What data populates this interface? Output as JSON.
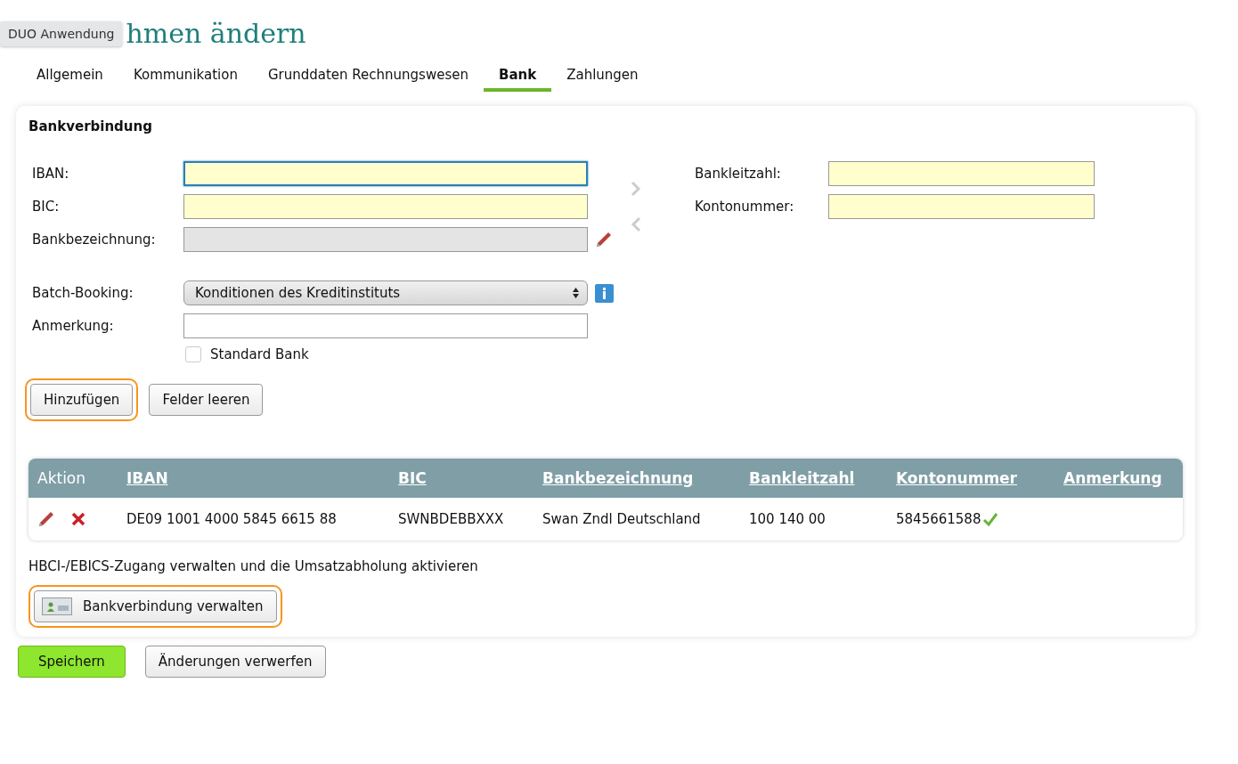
{
  "tooltip": "DUO Anwendung",
  "title": "hmen ändern",
  "tabs": [
    {
      "label": "Allgemein",
      "selected": false
    },
    {
      "label": "Kommunikation",
      "selected": false
    },
    {
      "label": "Grunddaten Rechnungswesen",
      "selected": false
    },
    {
      "label": "Bank",
      "selected": true
    },
    {
      "label": "Zahlungen",
      "selected": false
    }
  ],
  "section_title": "Bankverbindung",
  "left_fields": [
    {
      "label": "IBAN:",
      "focused": true,
      "disabled": false,
      "editable": false
    },
    {
      "label": "BIC:",
      "focused": false,
      "disabled": false,
      "editable": false
    },
    {
      "label": "Bankbezeichnung:",
      "focused": false,
      "disabled": true,
      "editable": true
    }
  ],
  "right_fields": [
    {
      "label": "Bankleitzahl:",
      "focused": false
    },
    {
      "label": "Kontonummer:",
      "focused": false
    }
  ],
  "batch_booking": {
    "label": "Batch-Booking:",
    "value": "Konditionen des Kreditinstituts"
  },
  "remark": {
    "label": "Anmerkung:"
  },
  "standard_bank": {
    "label": "Standard Bank",
    "checked": false
  },
  "form_buttons": [
    {
      "label": "Hinzufügen",
      "highlighted": true
    },
    {
      "label": "Felder leeren",
      "highlighted": false
    }
  ],
  "table": {
    "columns": [
      {
        "label": "Aktion",
        "sortable": false
      },
      {
        "label": "IBAN",
        "sortable": true
      },
      {
        "label": "BIC",
        "sortable": true
      },
      {
        "label": "Bankbezeichnung",
        "sortable": true
      },
      {
        "label": "Bankleitzahl",
        "sortable": true
      },
      {
        "label": "Kontonummer",
        "sortable": true
      },
      {
        "label": "Anmerkung",
        "sortable": true
      }
    ],
    "rows": [
      {
        "iban": "DE09 1001 4000 5845 6615 88",
        "bic": "SWNBDEBBXXX",
        "bank": "Swan Zndl Deutschland",
        "blz": "100 140 00",
        "account": "5845661588",
        "verified": true
      }
    ]
  },
  "hbci_text": "HBCI-/EBICS-Zugang verwalten und die Umsatzabholung aktivieren",
  "manage_button": {
    "label": "Bankverbindung verwalten",
    "highlighted": true
  },
  "footer_buttons": [
    {
      "label": "Speichern",
      "kind": "primary"
    },
    {
      "label": "Änderungen verwerfen",
      "kind": "secondary"
    }
  ]
}
